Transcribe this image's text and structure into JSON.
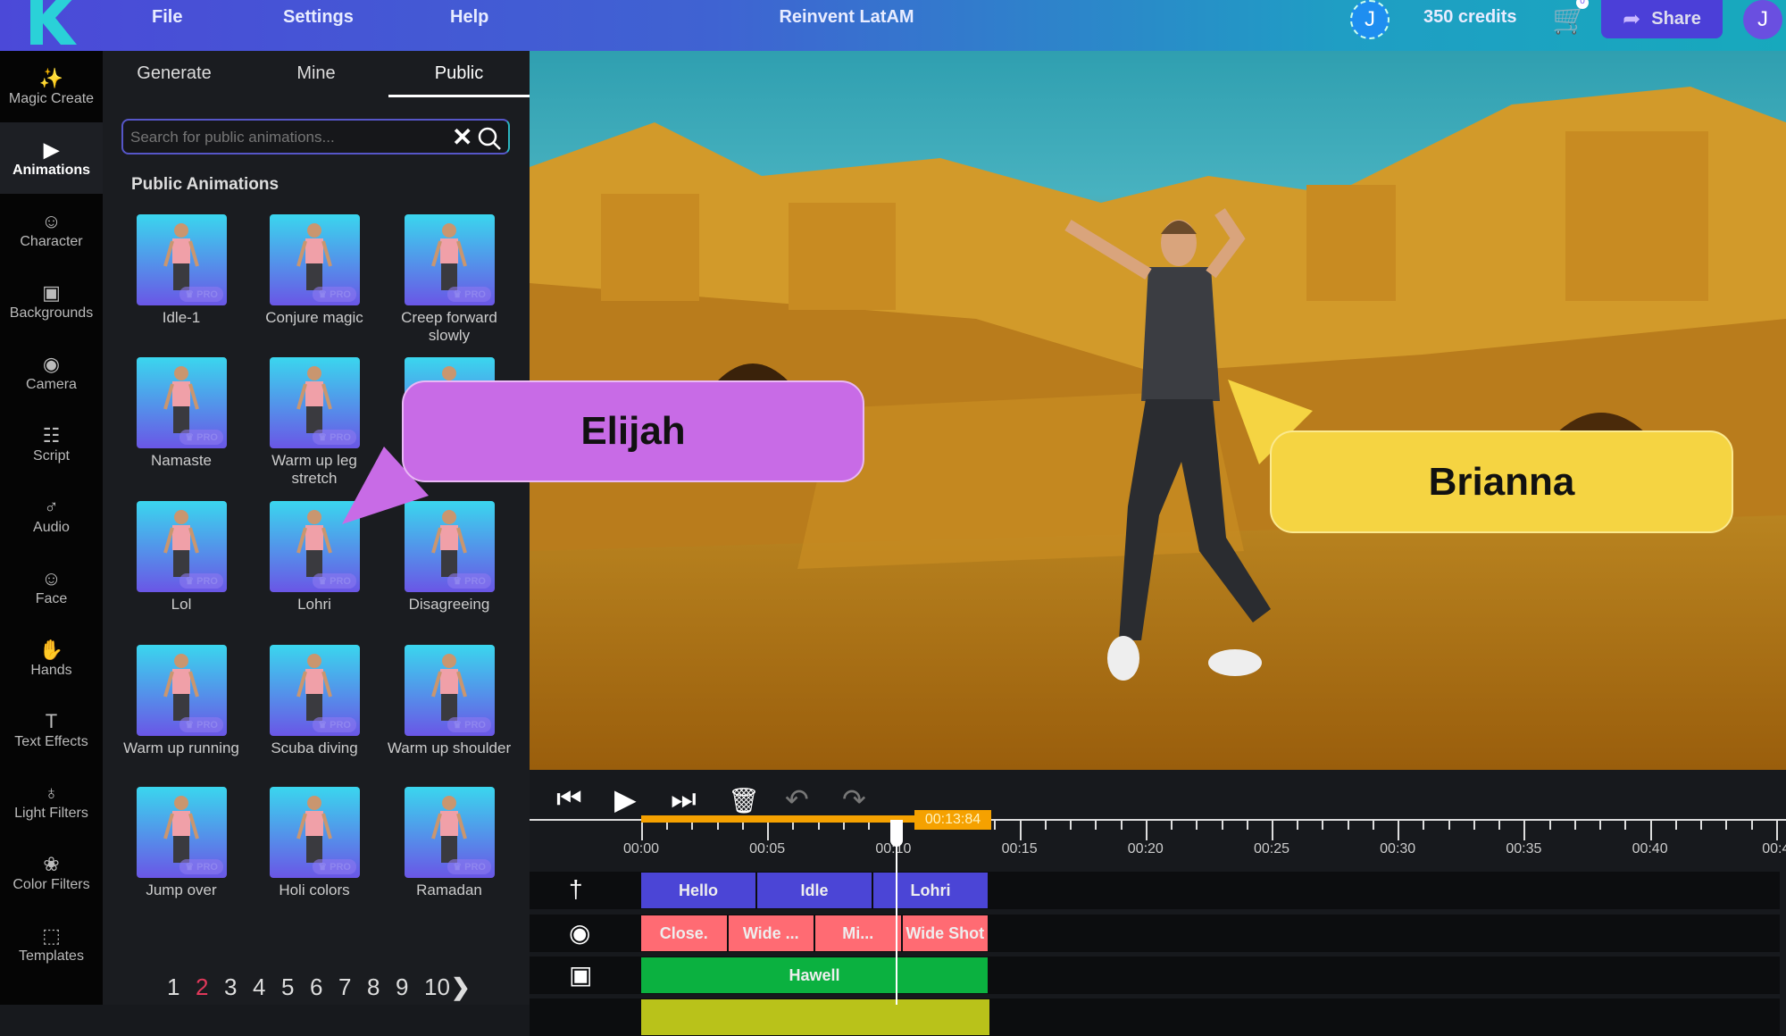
{
  "topbar": {
    "menu": [
      "File",
      "Settings",
      "Help"
    ],
    "project_title": "Reinvent LatAM",
    "user_initial": "J",
    "credits": "350 credits",
    "share_label": "Share",
    "profile_initial": "J",
    "cart_badge": "0"
  },
  "sidebar": {
    "items": [
      {
        "label": "Magic Create",
        "icon": "magic-wand-icon"
      },
      {
        "label": "Animations",
        "icon": "play-screen-icon",
        "active": true
      },
      {
        "label": "Character",
        "icon": "characters-icon"
      },
      {
        "label": "Backgrounds",
        "icon": "background-icon"
      },
      {
        "label": "Camera",
        "icon": "camera-icon"
      },
      {
        "label": "Script",
        "icon": "script-icon"
      },
      {
        "label": "Audio",
        "icon": "microphone-icon"
      },
      {
        "label": "Face",
        "icon": "face-icon"
      },
      {
        "label": "Hands",
        "icon": "hand-icon"
      },
      {
        "label": "Text Effects",
        "icon": "text-icon"
      },
      {
        "label": "Light Filters",
        "icon": "lightbulb-icon"
      },
      {
        "label": "Color Filters",
        "icon": "palette-icon"
      },
      {
        "label": "Templates",
        "icon": "templates-icon"
      }
    ]
  },
  "panel": {
    "tabs": [
      "Generate",
      "Mine",
      "Public"
    ],
    "active_tab": "Public",
    "search": {
      "placeholder": "Search for public animations...",
      "value": ""
    },
    "section_title": "Public Animations",
    "pro_badge": "PRO",
    "animations": [
      "Idle-1",
      "Conjure magic",
      "Creep forward slowly",
      "Namaste",
      "Warm up leg stretch",
      "",
      "Lol",
      "Lohri",
      "Disagreeing",
      "Warm up running",
      "Scuba diving",
      "Warm up shoulder",
      "Jump over",
      "Holi colors",
      "Ramadan"
    ],
    "pagination": {
      "pages": [
        "1",
        "2",
        "3",
        "4",
        "5",
        "6",
        "7",
        "8",
        "9",
        "10"
      ],
      "current": "2"
    }
  },
  "viewport": {
    "bubbles": [
      {
        "name": "Elijah",
        "color": "#c86be6"
      },
      {
        "name": "Brianna",
        "color": "#f5d442"
      }
    ]
  },
  "timeline": {
    "current_time": "00:13:84",
    "ticks": [
      "00:00",
      "00:05",
      "00:10",
      "00:15",
      "00:20",
      "00:25",
      "00:30",
      "00:35",
      "00:40",
      "00:4"
    ],
    "tracks": [
      {
        "icon": "person-icon",
        "color": "#4b45d6",
        "clips": [
          "Hello",
          "Idle",
          "Lohri"
        ]
      },
      {
        "icon": "camera-icon",
        "color": "#ff6b73",
        "clips": [
          "Close.",
          "Wide ...",
          "Mi...",
          "Wide Shot"
        ]
      },
      {
        "icon": "background-icon",
        "color": "#0bb140",
        "clips": [
          "Hawell"
        ]
      },
      {
        "icon": "",
        "color": "#b9c21a",
        "clips": []
      }
    ]
  },
  "colors": {
    "accent": "#f5a100",
    "active_page": "#e0385a"
  }
}
